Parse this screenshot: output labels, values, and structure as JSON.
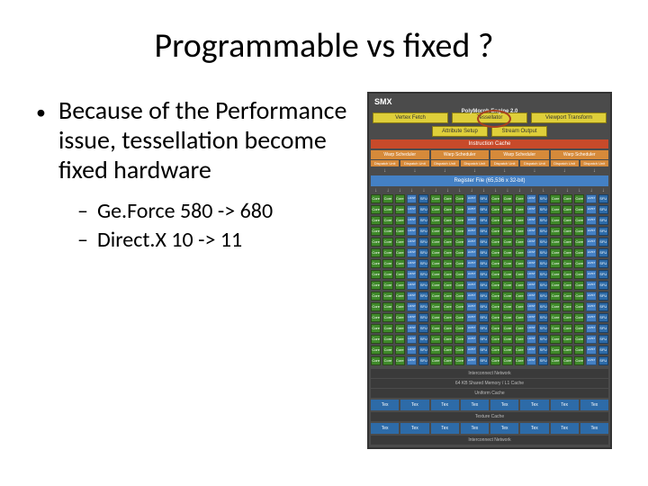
{
  "title": "Programmable vs fixed ?",
  "bullets": {
    "main": "Because of the Performance issue, tessellation become fixed hardware",
    "subs": [
      "Ge.Force 580 -> 680",
      "Direct.X 10 -> 11"
    ]
  },
  "diagram": {
    "header": "SMX",
    "engine_label": "PolyMorph Engine 2.0",
    "poly_top": [
      "Vertex Fetch",
      "Tessellator",
      "Viewport Transform"
    ],
    "poly_bottom": [
      "Attribute Setup",
      "Stream Output"
    ],
    "instr_cache": "Instruction Cache",
    "warp_label": "Warp Scheduler",
    "dispatch_label": "Dispatch Unit",
    "regfile": "Register File (65,536 x 32-bit)",
    "core_label": "Core",
    "ldst_label": "LD/ST",
    "sfu_label": "SFU",
    "interconnect": "Interconnect Network",
    "l1": "64 KB Shared Memory / L1 Cache",
    "uniform_cache": "Uniform Cache",
    "tex_label": "Tex",
    "tex_cache": "Texture Cache"
  }
}
